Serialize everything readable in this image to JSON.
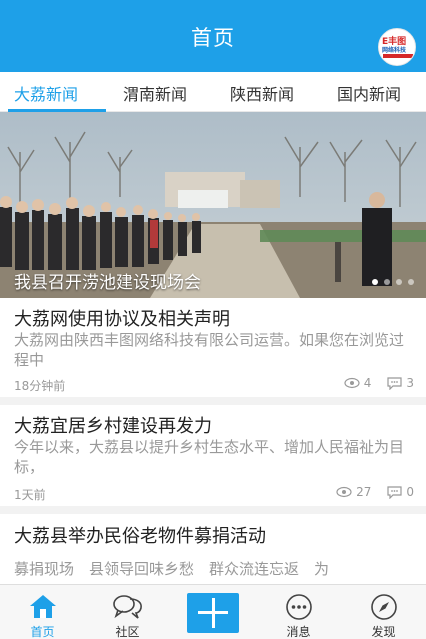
{
  "header": {
    "title": "首页",
    "logo_text_top": "E丰图",
    "logo_text_bottom": "网络科技"
  },
  "tabs": [
    {
      "label": "大荔新闻",
      "active": true
    },
    {
      "label": "渭南新闻",
      "active": false
    },
    {
      "label": "陕西新闻",
      "active": false
    },
    {
      "label": "国内新闻",
      "active": false
    }
  ],
  "banner": {
    "caption": "我县召开涝池建设现场会",
    "slides_total": 4,
    "slide_active": 1
  },
  "news": [
    {
      "title": "大荔网使用协议及相关声明",
      "summary": "大荔网由陕西丰图网络科技有限公司运营。如果您在浏览过程中",
      "time": "18分钟前",
      "views": "4",
      "comments": "3"
    },
    {
      "title": "大荔宜居乡村建设再发力",
      "summary": "今年以来，大荔县以提升乡村生态水平、增加人民福祉为目标，",
      "time": "1天前",
      "views": "27",
      "comments": "0"
    },
    {
      "title": "大荔县举办民俗老物件募捐活动",
      "summary": "募捐现场　县领导回味乡愁　群众流连忘返　为"
    }
  ],
  "bottom_nav": [
    {
      "label": "首页",
      "icon": "home-icon",
      "active": true
    },
    {
      "label": "社区",
      "icon": "chat-bubbles-icon",
      "active": false
    },
    {
      "label": "",
      "icon": "plus-icon",
      "active": false
    },
    {
      "label": "消息",
      "icon": "message-dots-icon",
      "active": false
    },
    {
      "label": "发现",
      "icon": "compass-icon",
      "active": false
    }
  ],
  "colors": {
    "accent": "#1ea0e8",
    "text": "#222222",
    "muted": "#999999"
  }
}
